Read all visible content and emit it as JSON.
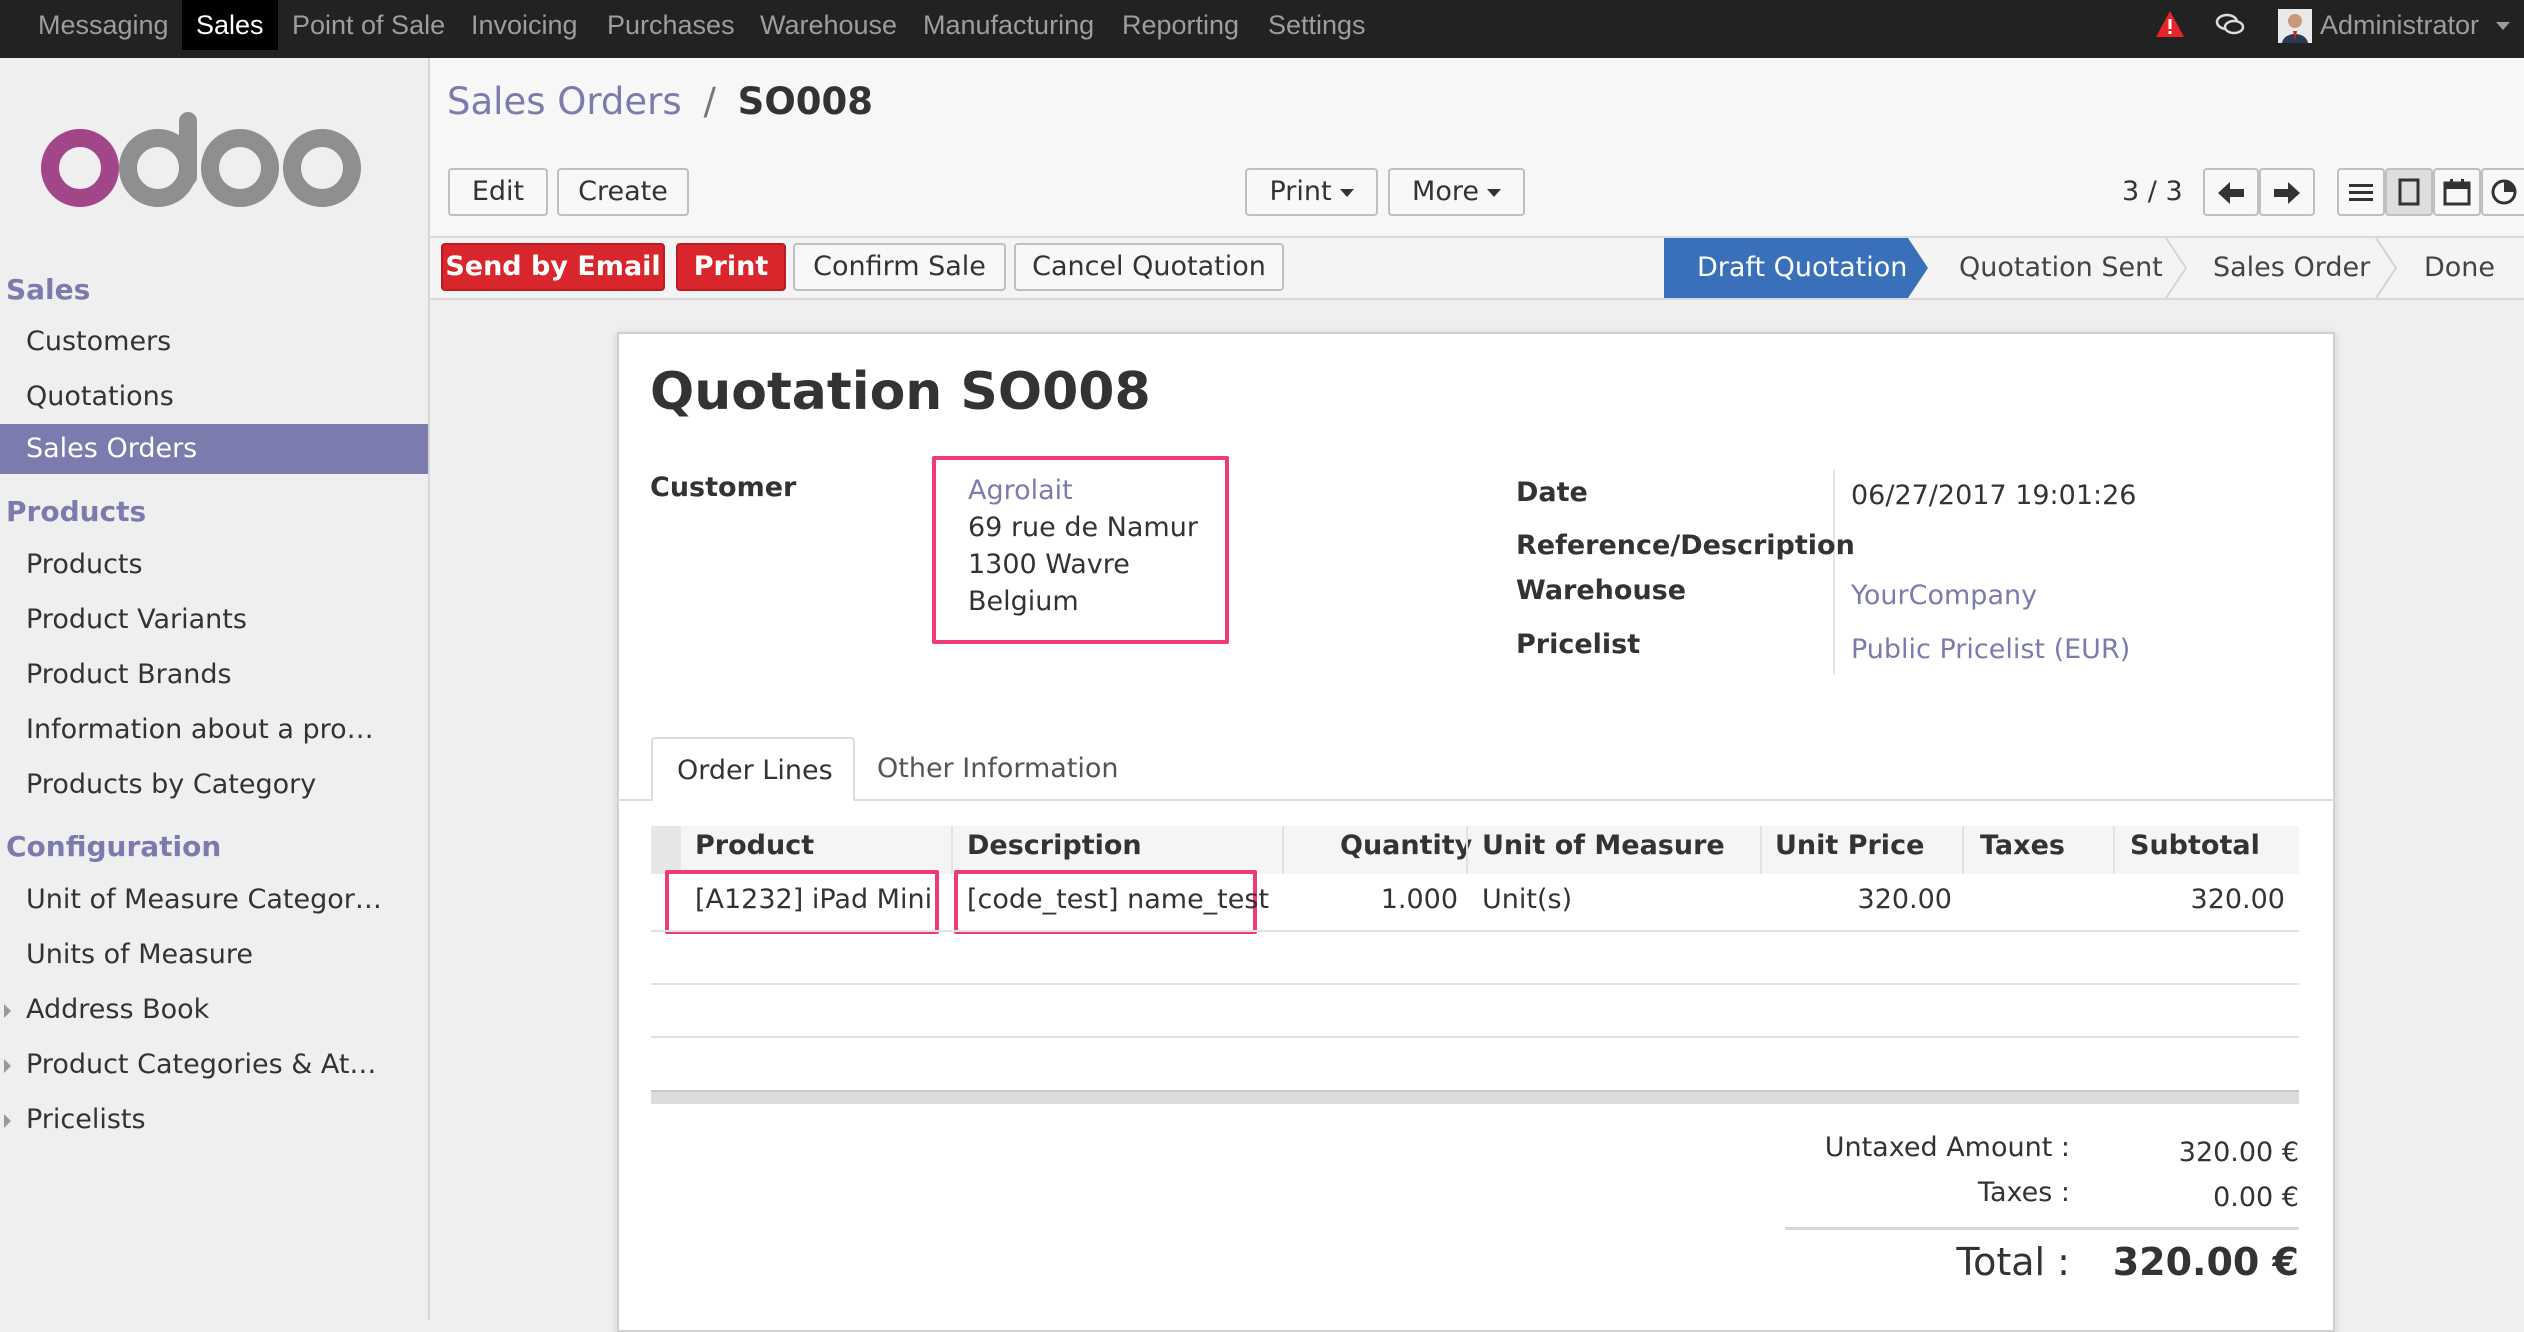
{
  "topnav": {
    "items": [
      "Messaging",
      "Sales",
      "Point of Sale",
      "Invoicing",
      "Purchases",
      "Warehouse",
      "Manufacturing",
      "Reporting",
      "Settings"
    ],
    "active": "Sales",
    "user": "Administrator"
  },
  "sidebar": {
    "logo": "odoo",
    "sections": [
      {
        "title": "Sales",
        "items": [
          "Customers",
          "Quotations",
          "Sales Orders"
        ]
      },
      {
        "title": "Products",
        "items": [
          "Products",
          "Product Variants",
          "Product Brands",
          "Information about a pro…",
          "Products by Category"
        ]
      },
      {
        "title": "Configuration",
        "items": [
          "Unit of Measure Categor…",
          "Units of Measure",
          "Address Book",
          "Product Categories & At…",
          "Pricelists"
        ]
      }
    ],
    "active_item": "Sales Orders"
  },
  "breadcrumb": {
    "parent": "Sales Orders",
    "separator": "/",
    "current": "SO008"
  },
  "toolbar": {
    "edit": "Edit",
    "create": "Create",
    "print": "Print",
    "more": "More",
    "pager": "3 / 3"
  },
  "header_buttons": {
    "send_email": "Send by Email",
    "print": "Print",
    "confirm": "Confirm Sale",
    "cancel": "Cancel Quotation"
  },
  "statusbar": {
    "stages": [
      "Draft Quotation",
      "Quotation Sent",
      "Sales Order",
      "Done"
    ],
    "active": "Draft Quotation"
  },
  "form": {
    "title": "Quotation SO008",
    "customer_label": "Customer",
    "customer": {
      "name": "Agrolait",
      "street": "69 rue de Namur",
      "city": "1300 Wavre",
      "country": "Belgium"
    },
    "date_label": "Date",
    "date": "06/27/2017 19:01:26",
    "reference_label": "Reference/Description",
    "warehouse_label": "Warehouse",
    "warehouse": "YourCompany",
    "pricelist_label": "Pricelist",
    "pricelist": "Public Pricelist (EUR)"
  },
  "tabs": [
    "Order Lines",
    "Other Information"
  ],
  "order_lines": {
    "columns": [
      "Product",
      "Description",
      "Quantity",
      "Unit of Measure",
      "Unit Price",
      "Taxes",
      "Subtotal"
    ],
    "rows": [
      {
        "product": "[A1232] iPad Mini",
        "description": "[code_test] name_test",
        "quantity": "1.000",
        "uom": "Unit(s)",
        "unit_price": "320.00",
        "taxes": "",
        "subtotal": "320.00"
      }
    ]
  },
  "totals": {
    "untaxed_label": "Untaxed Amount :",
    "untaxed": "320.00 €",
    "taxes_label": "Taxes :",
    "taxes": "0.00 €",
    "total_label": "Total :",
    "total": "320.00 €"
  },
  "colors": {
    "brand_purple": "#7c7bad",
    "odoo_magenta": "#a24689",
    "status_blue": "#3a6fb9",
    "danger_red": "#d9262c",
    "highlight_pink": "#ef3b74"
  }
}
